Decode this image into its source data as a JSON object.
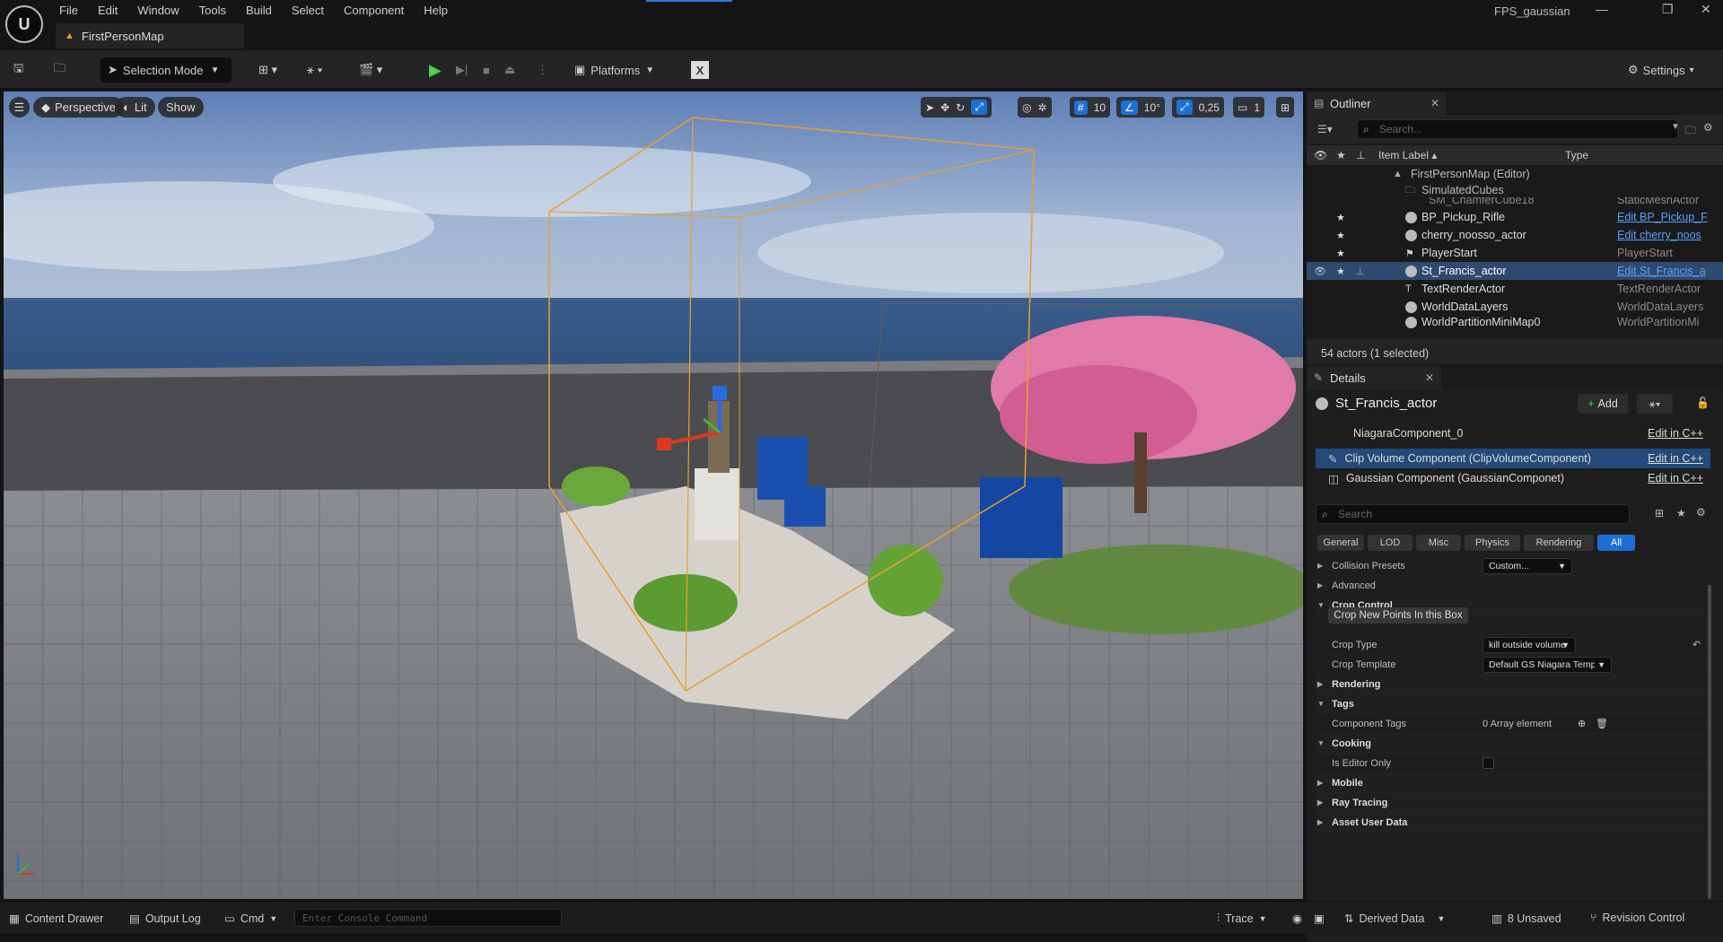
{
  "menu": [
    "File",
    "Edit",
    "Window",
    "Tools",
    "Build",
    "Select",
    "Component",
    "Help"
  ],
  "project_name": "FPS_gaussian",
  "map_tab": "FirstPersonMap",
  "toolbar": {
    "selection_mode": "Selection Mode",
    "platforms": "Platforms",
    "settings": "Settings"
  },
  "viewport": {
    "perspective": "Perspective",
    "lit": "Lit",
    "show": "Show",
    "grid_snap": "10",
    "rot_snap": "10°",
    "scale_snap": "0,25",
    "camera_speed": "1"
  },
  "outliner": {
    "tab": "Outliner",
    "search_placeholder": "Search...",
    "col_label": "Item Label ▴",
    "col_type": "Type",
    "rows": [
      {
        "label": "FirstPersonMap (Editor)",
        "type": ""
      },
      {
        "label": "SimulatedCubes",
        "type": ""
      },
      {
        "label": "SM_ChamferCube18",
        "type": "StaticMeshActor"
      },
      {
        "label": "BP_Pickup_Rifle",
        "type": "Edit BP_Pickup_F"
      },
      {
        "label": "cherry_noosso_actor",
        "type": "Edit cherry_noos"
      },
      {
        "label": "PlayerStart",
        "type": "PlayerStart"
      },
      {
        "label": "St_Francis_actor",
        "type": "Edit St_Francis_a"
      },
      {
        "label": "TextRenderActor",
        "type": "TextRenderActor"
      },
      {
        "label": "WorldDataLayers",
        "type": "WorldDataLayers"
      },
      {
        "label": "WorldPartitionMiniMap0",
        "type": "WorldPartitionMi"
      }
    ],
    "footer": "54 actors (1 selected)"
  },
  "details": {
    "tab": "Details",
    "actor_name": "St_Francis_actor",
    "add_label": "Add",
    "components": [
      {
        "label": "NiagaraComponent_0",
        "edit": "Edit in C++"
      },
      {
        "label": "Clip Volume Component (ClipVolumeComponent)",
        "edit": "Edit in C++"
      },
      {
        "label": "Gaussian Component (GaussianComponet)",
        "edit": "Edit in C++"
      }
    ],
    "search_placeholder": "Search",
    "filters": [
      "General",
      "LOD",
      "Misc",
      "Physics",
      "Rendering",
      "All"
    ],
    "collision_presets": {
      "label": "Collision Presets",
      "value": "Custom..."
    },
    "advanced": "Advanced",
    "crop_control": "Crop Control",
    "crop_button": "Crop New Points In this Box",
    "crop_type": {
      "label": "Crop Type",
      "value": "kill outside volume"
    },
    "crop_template": {
      "label": "Crop Template",
      "value": "Default GS Niagara Template"
    },
    "rendering": "Rendering",
    "tags": "Tags",
    "component_tags": {
      "label": "Component Tags",
      "value": "0 Array element"
    },
    "cooking": "Cooking",
    "is_editor_only": "Is Editor Only",
    "mobile": "Mobile",
    "ray_tracing": "Ray Tracing",
    "asset_user_data": "Asset User Data"
  },
  "statusbar": {
    "content_drawer": "Content Drawer",
    "output_log": "Output Log",
    "cmd": "Cmd",
    "console_placeholder": "Enter Console Command",
    "trace": "Trace",
    "derived_data": "Derived Data",
    "unsaved": "8 Unsaved",
    "revision_control": "Revision Control"
  },
  "colors": {
    "accent": "#1d6fd6",
    "selection": "#2f4a6e",
    "bounds": "#e8a030"
  }
}
